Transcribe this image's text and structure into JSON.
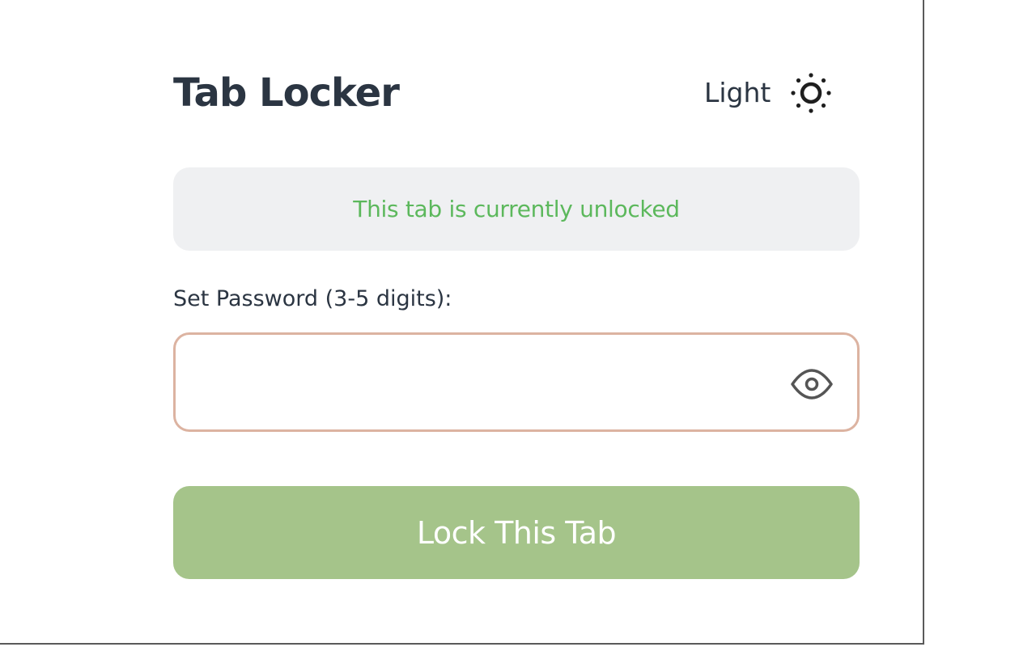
{
  "app": {
    "title": "Tab Locker"
  },
  "theme": {
    "label": "Light",
    "icon": "sun-icon"
  },
  "status": {
    "text": "This tab is currently unlocked",
    "color": "#5cb85c"
  },
  "password": {
    "label": "Set Password (3-5 digits):",
    "value": "",
    "placeholder": "",
    "toggle_icon": "eye-icon"
  },
  "actions": {
    "lock_label": "Lock This Tab",
    "lock_color": "#a5c48a"
  }
}
